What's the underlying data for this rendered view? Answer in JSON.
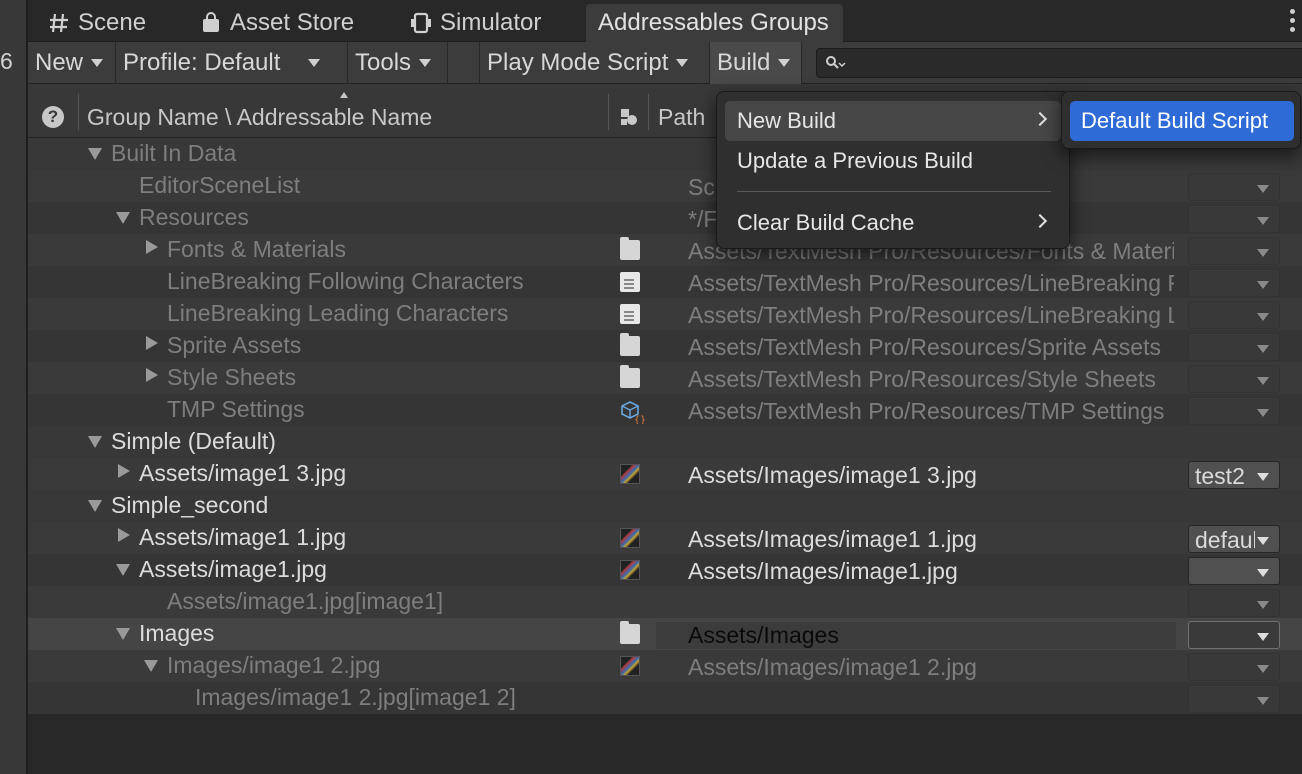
{
  "left_strip": {
    "number": "6"
  },
  "tabs": [
    {
      "label": "Scene",
      "icon": "grid-icon"
    },
    {
      "label": "Asset Store",
      "icon": "shopping-bag-icon"
    },
    {
      "label": "Simulator",
      "icon": "device-icon"
    },
    {
      "label": "Addressables Groups",
      "active": true
    }
  ],
  "toolbar": {
    "new_label": "New",
    "profile_label": "Profile: Default",
    "tools_label": "Tools",
    "play_mode_label": "Play Mode Script",
    "build_label": "Build",
    "search_placeholder": ""
  },
  "header": {
    "help": "?",
    "group_name": "Group Name \\ Addressable Name",
    "path": "Path"
  },
  "rows": [
    {
      "label": "Built In Data",
      "path": "",
      "dropdown": ""
    },
    {
      "label": "EditorSceneList",
      "path": "Sc",
      "dropdown": ""
    },
    {
      "label": "Resources",
      "path": "*/F",
      "dropdown": ""
    },
    {
      "label": "Fonts & Materials",
      "path": "Assets/TextMesh Pro/Resources/Fonts & Materials",
      "dropdown": ""
    },
    {
      "label": "LineBreaking Following Characters",
      "path": "Assets/TextMesh Pro/Resources/LineBreaking Following Characters",
      "dropdown": ""
    },
    {
      "label": "LineBreaking Leading Characters",
      "path": "Assets/TextMesh Pro/Resources/LineBreaking Leading Characters",
      "dropdown": ""
    },
    {
      "label": "Sprite Assets",
      "path": "Assets/TextMesh Pro/Resources/Sprite Assets",
      "dropdown": ""
    },
    {
      "label": "Style Sheets",
      "path": "Assets/TextMesh Pro/Resources/Style Sheets",
      "dropdown": ""
    },
    {
      "label": "TMP Settings",
      "path": "Assets/TextMesh Pro/Resources/TMP Settings",
      "dropdown": ""
    },
    {
      "label": "Simple (Default)",
      "path": "",
      "dropdown": ""
    },
    {
      "label": "Assets/image1 3.jpg",
      "path": "Assets/Images/image1 3.jpg",
      "dropdown": "test2"
    },
    {
      "label": "Simple_second",
      "path": "",
      "dropdown": ""
    },
    {
      "label": "Assets/image1 1.jpg",
      "path": "Assets/Images/image1 1.jpg",
      "dropdown": "default"
    },
    {
      "label": "Assets/image1.jpg",
      "path": "Assets/Images/image1.jpg",
      "dropdown": ""
    },
    {
      "label": "Assets/image1.jpg[image1]",
      "path": "",
      "dropdown": ""
    },
    {
      "label": "Images",
      "path": "Assets/Images",
      "dropdown": ""
    },
    {
      "label": "Images/image1 2.jpg",
      "path": "Assets/Images/image1 2.jpg",
      "dropdown": ""
    },
    {
      "label": "Images/image1 2.jpg[image1 2]",
      "path": "",
      "dropdown": ""
    }
  ],
  "build_menu": {
    "new_build": "New Build",
    "update_previous": "Update a Previous Build",
    "clear_cache": "Clear Build Cache"
  },
  "new_build_submenu": {
    "default_script": "Default Build Script"
  },
  "colors": {
    "accent": "#2e6bd6",
    "panel": "#383838",
    "toolbar": "#3c3c3c"
  }
}
